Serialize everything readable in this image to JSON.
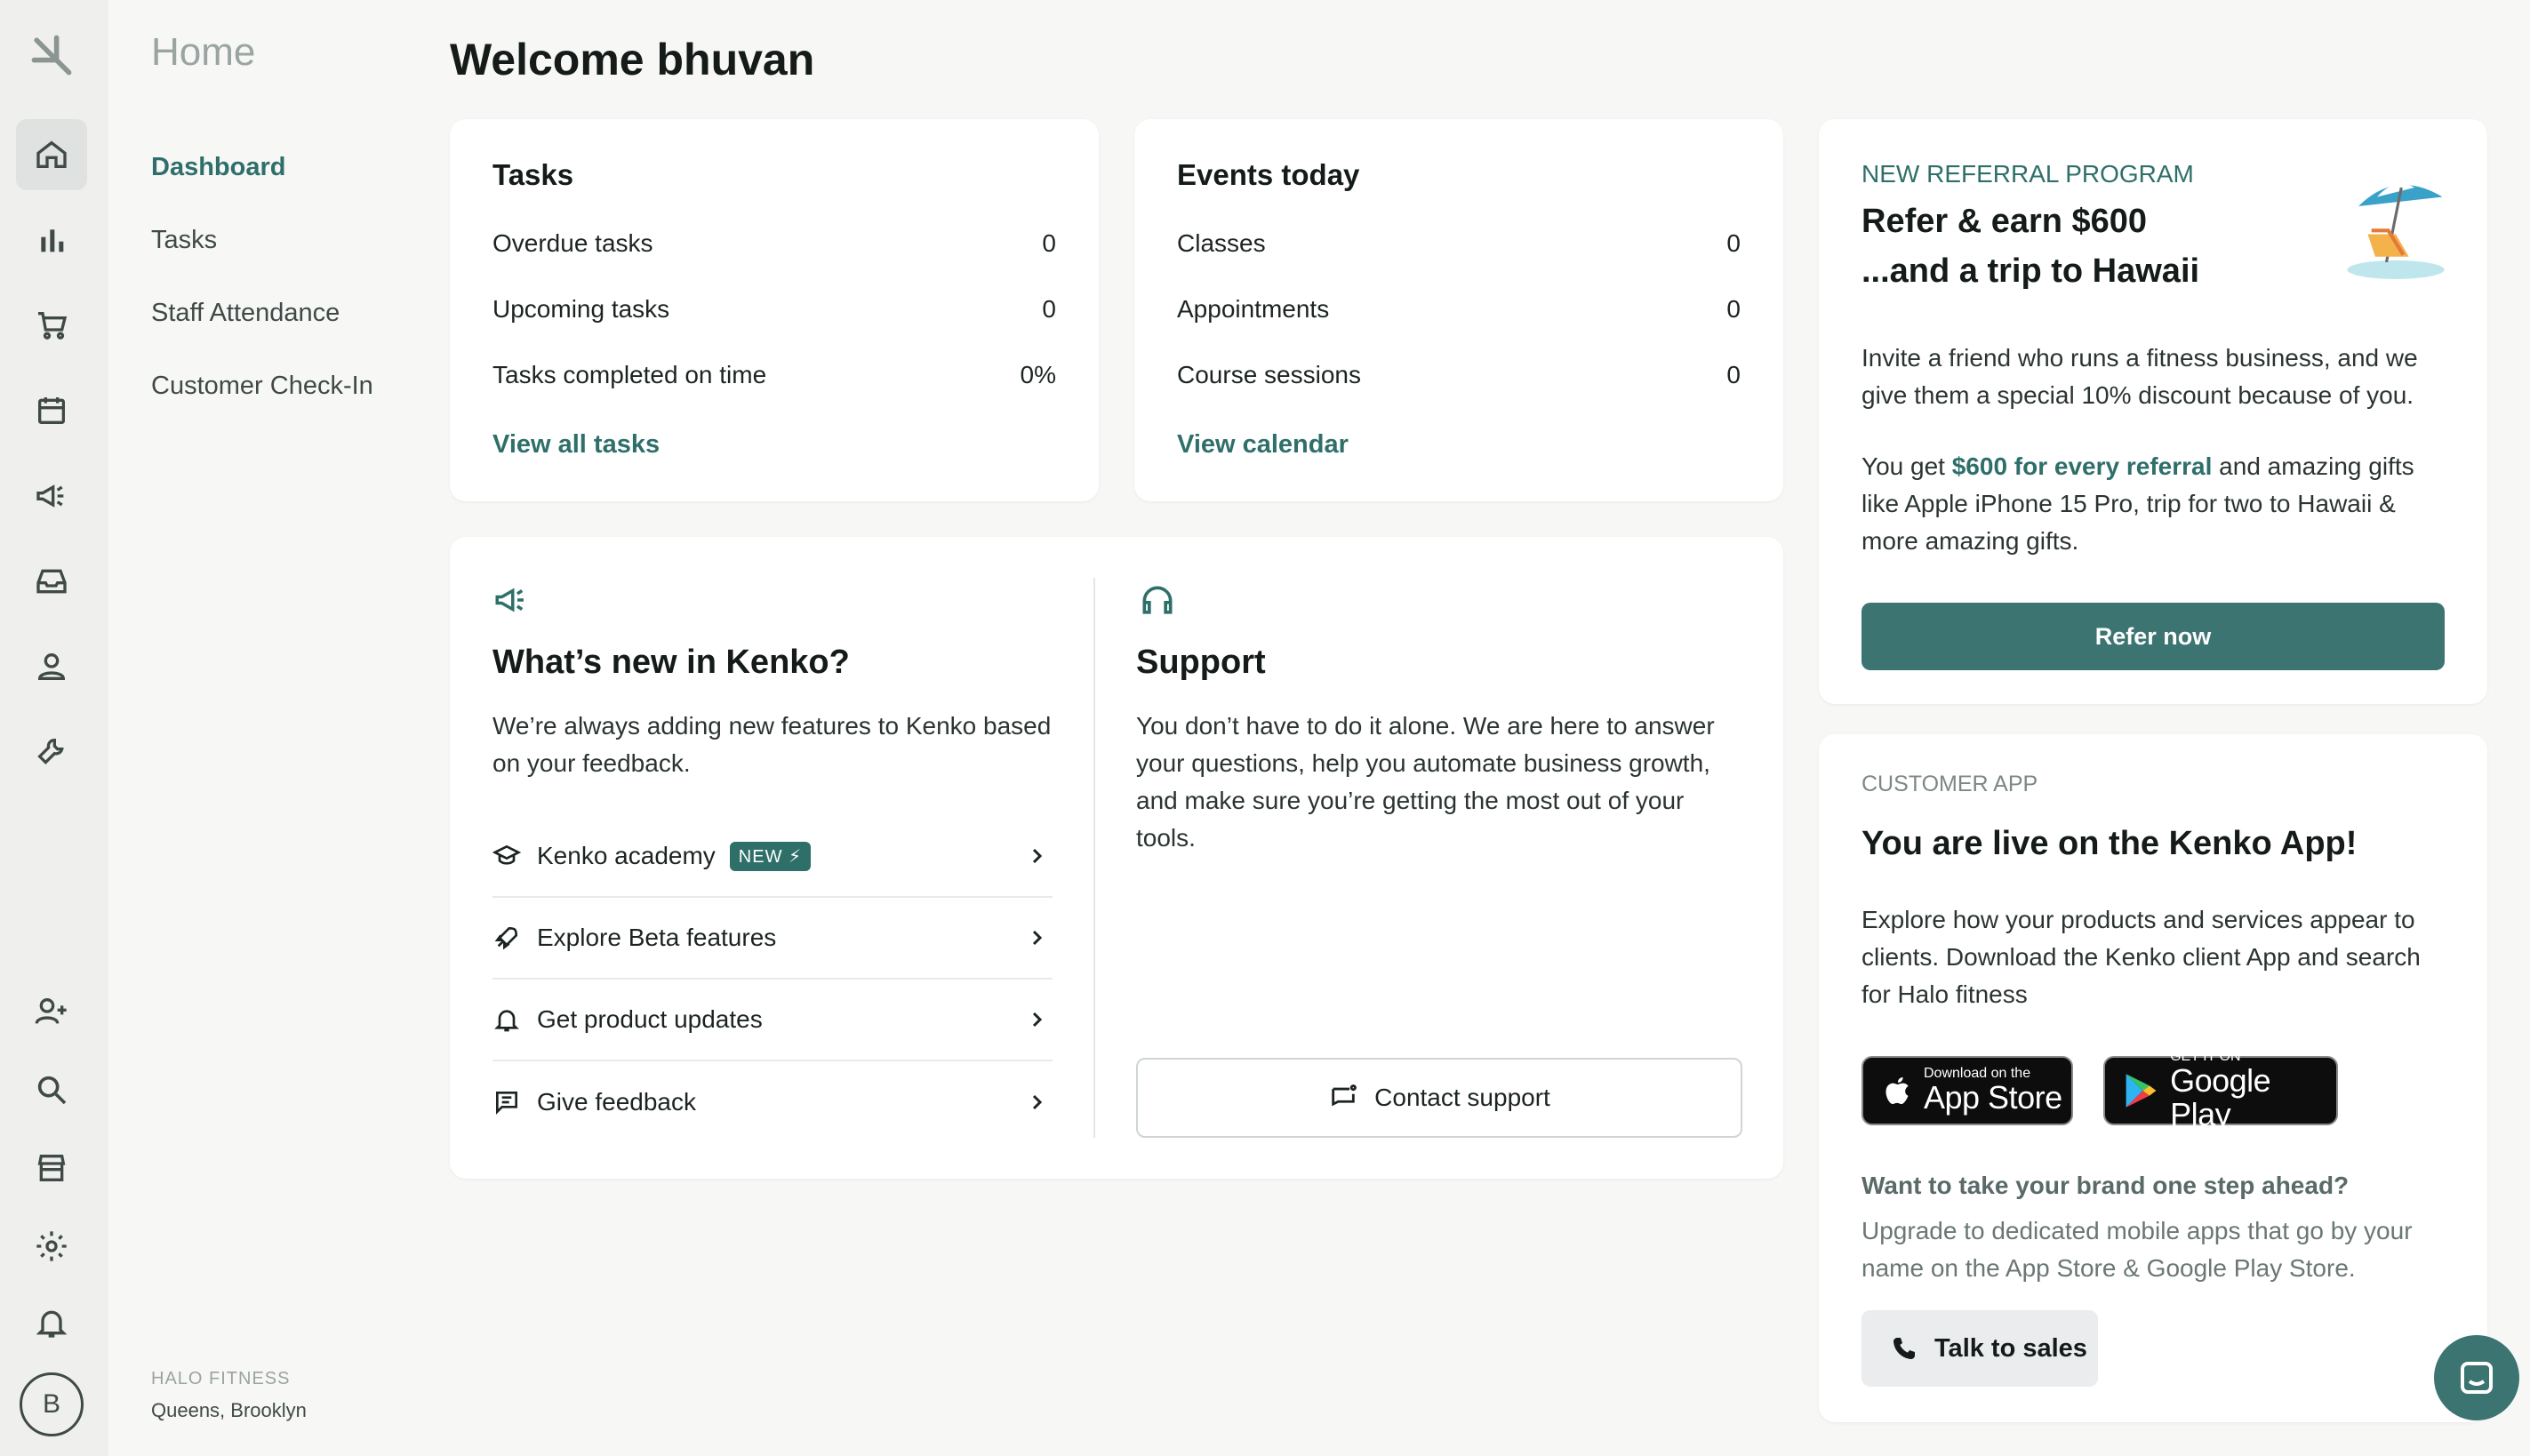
{
  "nav": {
    "title": "Home",
    "items": [
      {
        "label": "Dashboard"
      },
      {
        "label": "Tasks"
      },
      {
        "label": "Staff Attendance"
      },
      {
        "label": "Customer Check-In"
      }
    ],
    "org_name": "HALO FITNESS",
    "org_location": "Queens, Brooklyn",
    "avatar_letter": "B"
  },
  "welcome": "Welcome bhuvan",
  "tasks": {
    "title": "Tasks",
    "rows": [
      {
        "label": "Overdue tasks",
        "value": "0"
      },
      {
        "label": "Upcoming tasks",
        "value": "0"
      },
      {
        "label": "Tasks completed on time",
        "value": "0%"
      }
    ],
    "link": "View all tasks"
  },
  "events": {
    "title": "Events today",
    "rows": [
      {
        "label": "Classes",
        "value": "0"
      },
      {
        "label": "Appointments",
        "value": "0"
      },
      {
        "label": "Course sessions",
        "value": "0"
      }
    ],
    "link": "View calendar"
  },
  "whats_new": {
    "title": "What’s new in Kenko?",
    "text": "We’re always adding new features to Kenko based on your feedback.",
    "items": [
      {
        "label": "Kenko academy",
        "badge": "NEW ⚡"
      },
      {
        "label": "Explore Beta features"
      },
      {
        "label": "Get product updates"
      },
      {
        "label": "Give feedback"
      }
    ]
  },
  "support": {
    "title": "Support",
    "text": "You don’t have to do it alone. We are here to answer your questions, help you automate business growth, and make sure you’re getting the most out of your tools.",
    "button": "Contact support"
  },
  "referral": {
    "eyebrow": "NEW REFERRAL PROGRAM",
    "title_line1": "Refer & earn $600",
    "title_line2": "...and a trip to Hawaii",
    "text1": "Invite a friend who runs a fitness business, and we give them a special 10% discount because of you.",
    "text2_pre": "You get ",
    "text2_highlight": "$600 for every referral",
    "text2_post": " and amazing gifts like Apple iPhone 15 Pro, trip for two to Hawaii & more amazing gifts.",
    "button": "Refer now"
  },
  "customer_app": {
    "eyebrow": "CUSTOMER APP",
    "title": "You are live on the Kenko App!",
    "text": "Explore how your products and services appear to clients. Download the Kenko client App and search for Halo fitness",
    "appstore_small": "Download on the",
    "appstore_big": "App Store",
    "googleplay_small": "GET IT ON",
    "googleplay_big": "Google Play",
    "upsell_title": "Want to take your brand one step ahead?",
    "upsell_text": "Upgrade to dedicated mobile apps that go by your name on the App Store & Google Play Store.",
    "talk_button": "Talk to sales"
  },
  "colors": {
    "accent": "#2f6f6a",
    "button": "#3b7471",
    "background": "#f7f7f6"
  }
}
